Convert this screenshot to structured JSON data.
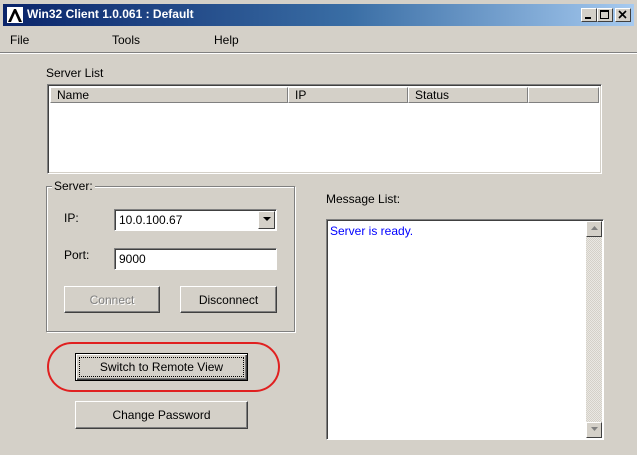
{
  "window": {
    "title": "Win32 Client 1.0.061 : Default"
  },
  "menu": {
    "file": "File",
    "tools": "Tools",
    "help": "Help"
  },
  "server_list": {
    "label": "Server List",
    "columns": [
      "Name",
      "IP",
      "Status",
      ""
    ]
  },
  "server": {
    "group_label": "Server:",
    "ip_label": "IP:",
    "ip_value": "10.0.100.67",
    "port_label": "Port:",
    "port_value": "9000",
    "connect_label": "Connect",
    "disconnect_label": "Disconnect"
  },
  "actions": {
    "switch_label": "Switch to Remote View",
    "change_password_label": "Change Password"
  },
  "messages": {
    "label": "Message List:",
    "lines": [
      "Server is ready."
    ]
  },
  "colors": {
    "title_bar_start": "#0a246a",
    "title_bar_end": "#a6caf0",
    "message_text": "#0000ff",
    "highlight_ring": "#e02020",
    "window_face": "#d4d0c8"
  },
  "icons": {
    "app": "aten-logo-icon",
    "minimize": "minimize-icon",
    "maximize": "maximize-icon",
    "close": "close-icon",
    "dropdown": "chevron-down-icon",
    "scroll_up": "scroll-up-arrow-icon",
    "scroll_down": "scroll-down-arrow-icon"
  }
}
